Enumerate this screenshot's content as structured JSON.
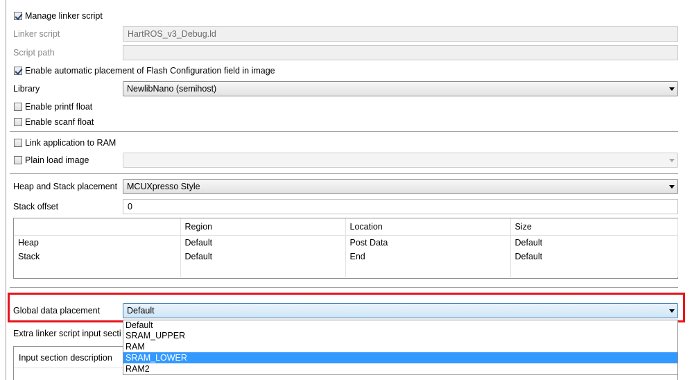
{
  "manage_linker_script": {
    "label": "Manage linker script",
    "checked": true
  },
  "linker_script": {
    "label": "Linker script",
    "value": "HartROS_v3_Debug.ld"
  },
  "script_path": {
    "label": "Script path",
    "value": ""
  },
  "flash_config": {
    "label": "Enable automatic placement of Flash Configuration field in image",
    "checked": true
  },
  "library": {
    "label": "Library",
    "value": "NewlibNano (semihost)"
  },
  "printf_float": {
    "label": "Enable printf float",
    "checked": false
  },
  "scanf_float": {
    "label": "Enable scanf float",
    "checked": false
  },
  "link_to_ram": {
    "label": "Link application to RAM",
    "checked": false
  },
  "plain_load_image": {
    "label": "Plain load image",
    "checked": false,
    "value": ""
  },
  "heap_stack_placement": {
    "label": "Heap and Stack placement",
    "value": "MCUXpresso Style"
  },
  "stack_offset": {
    "label": "Stack offset",
    "value": "0"
  },
  "heap_stack_table": {
    "columns": [
      "",
      "Region",
      "Location",
      "Size"
    ],
    "rows": [
      [
        "Heap",
        "Default",
        "Post Data",
        "Default"
      ],
      [
        "Stack",
        "Default",
        "End",
        "Default"
      ]
    ]
  },
  "global_data_placement": {
    "label": "Global data placement",
    "value": "Default",
    "options": [
      "Default",
      "SRAM_UPPER",
      "RAM",
      "SRAM_LOWER",
      "RAM2"
    ],
    "highlighted": "SRAM_LOWER"
  },
  "extra_linker": {
    "label": "Extra linker script input secti"
  },
  "input_section_table": {
    "column": "Input section description"
  },
  "colors": {
    "highlight_box": "#e8141b",
    "selection": "#3399ff"
  }
}
